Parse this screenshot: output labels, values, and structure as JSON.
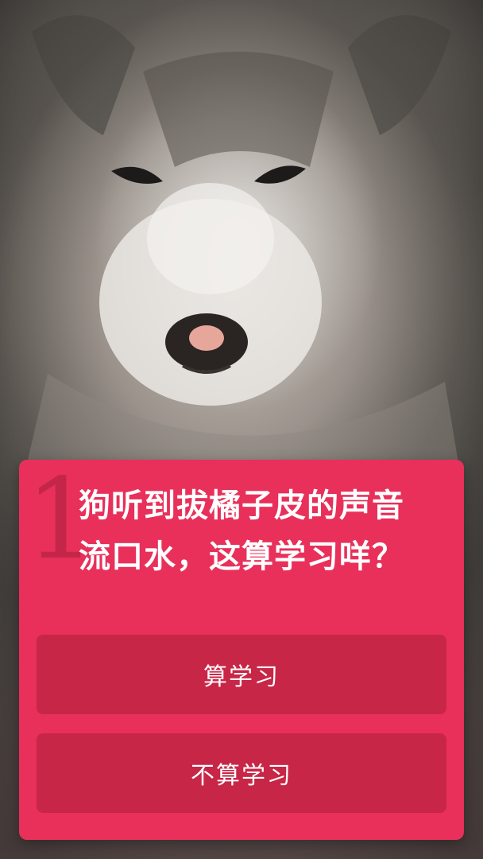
{
  "quiz": {
    "question_number": "1",
    "question_line1": "狗听到拔橘子皮的声音",
    "question_line2": "流口水，这算学习咩？",
    "options": [
      {
        "label": "算学习"
      },
      {
        "label": "不算学习"
      }
    ]
  },
  "colors": {
    "card_background": "#e8305a",
    "option_background": "#c82647",
    "text": "#ffffff"
  }
}
